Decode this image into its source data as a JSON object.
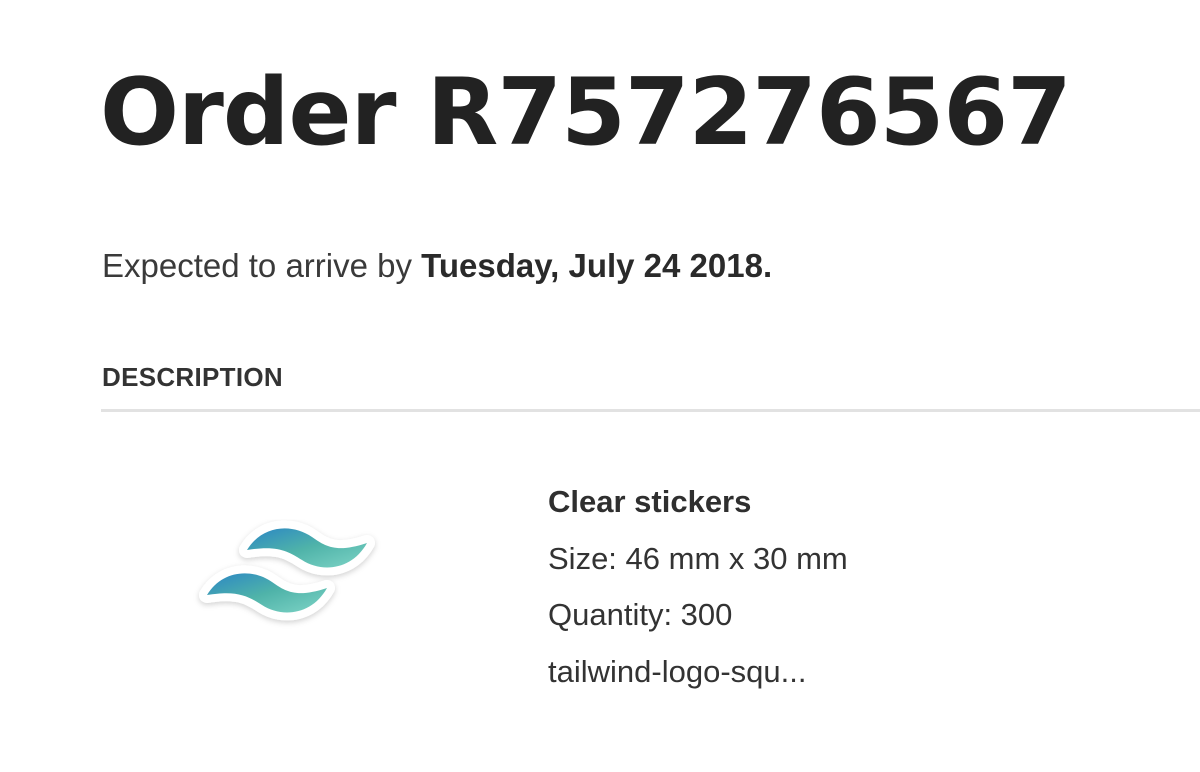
{
  "order": {
    "title": "Order R757276567"
  },
  "arrival": {
    "prefix": "Expected to arrive by ",
    "date": "Tuesday, July 24 2018."
  },
  "table": {
    "header": "DESCRIPTION"
  },
  "item": {
    "name": "Clear stickers",
    "size": "Size: 46 mm x 30 mm",
    "quantity": "Quantity: 300",
    "filename": "tailwind-logo-squ...",
    "thumbnail_icon": "tailwind-logo-icon",
    "logo_gradient": [
      "#2b86c5",
      "#4fb3a9",
      "#7ed4c6"
    ]
  }
}
